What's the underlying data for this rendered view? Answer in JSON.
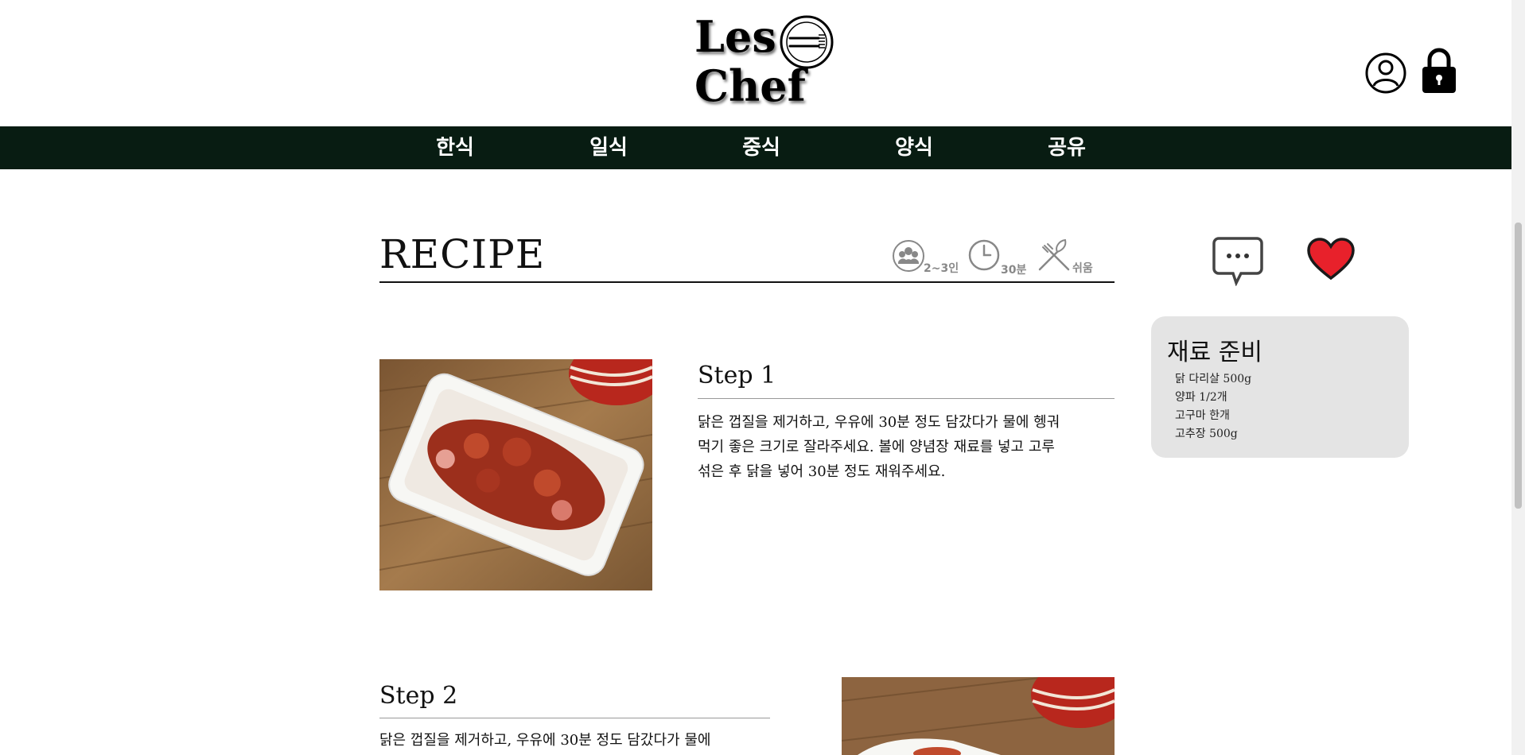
{
  "brand": {
    "line1": "Les",
    "line2": "Chef"
  },
  "nav": {
    "items": [
      {
        "label": "한식"
      },
      {
        "label": "일식"
      },
      {
        "label": "중식"
      },
      {
        "label": "양식"
      },
      {
        "label": "공유"
      }
    ]
  },
  "recipe": {
    "title": "RECIPE",
    "meta": {
      "servings": "2~3인",
      "time": "30분",
      "difficulty": "쉬움"
    }
  },
  "ingredients": {
    "title": "재료 준비",
    "items": [
      "닭 다리살 500g",
      "양파 1/2개",
      "고구마 한개",
      "고추장 500g"
    ]
  },
  "steps": [
    {
      "title": "Step 1",
      "lines": [
        "닭은 껍질을 제거하고, 우유에 30분 정도 담갔다가 물에 헹궈",
        "먹기 좋은 크기로 잘라주세요. 볼에 양념장 재료를 넣고 고루",
        "섞은 후 닭을 넣어 30분 정도 재워주세요."
      ]
    },
    {
      "title": "Step 2",
      "lines": [
        "닭은 껍질을 제거하고, 우유에 30분 정도 담갔다가 물에"
      ]
    }
  ],
  "icons": {
    "user": "user-icon",
    "lock": "lock-icon",
    "comment": "comment-icon",
    "heart": "heart-icon",
    "servings": "people-icon",
    "time": "clock-icon",
    "difficulty": "utensils-icon"
  },
  "colors": {
    "nav_bg": "#081c12",
    "heart": "#e8212b",
    "panel_bg": "#e4e4e4"
  }
}
